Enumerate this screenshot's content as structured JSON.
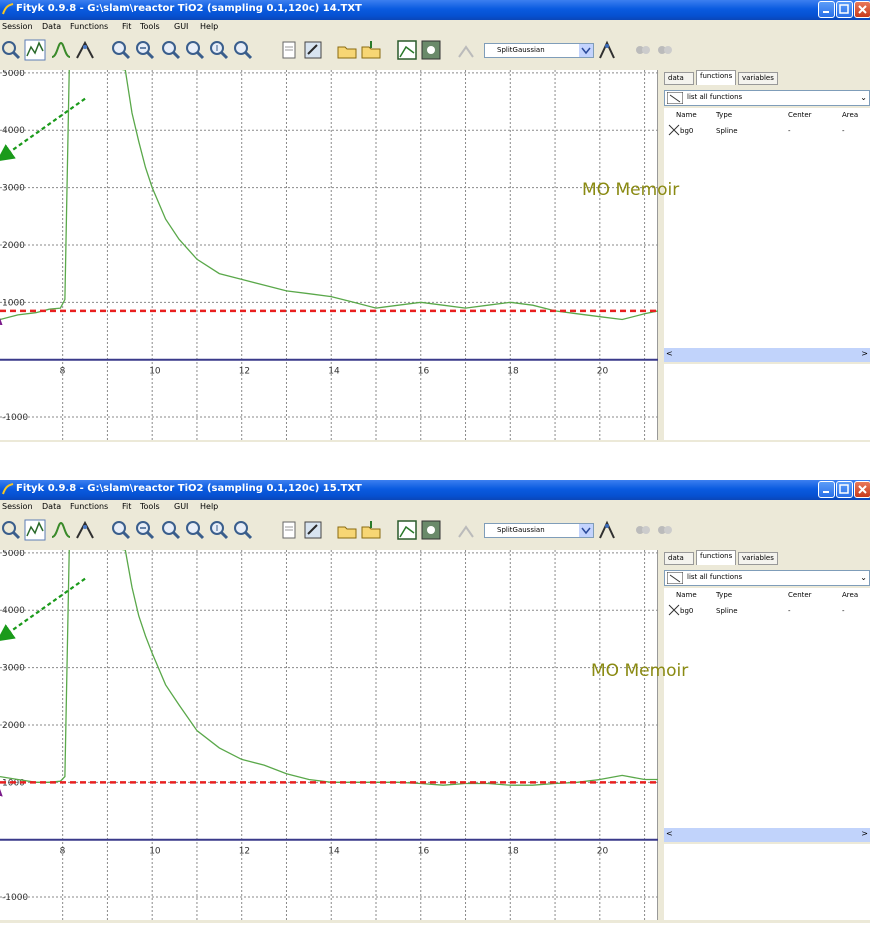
{
  "windows": [
    {
      "title": "Fityk 0.9.8 - G:\\slam\\reactor TiO2 (sampling 0.1,120c) 14.TXT",
      "menu": [
        "Session",
        "Data",
        "Functions",
        "Fit",
        "Tools",
        "GUI",
        "Help"
      ],
      "toolbar": {
        "icons": [
          "zoom-all-icon",
          "data-range-icon",
          "add-peak-icon",
          "run-fit-icon",
          "zoom-icon",
          "zoom-out-icon",
          "zoom-previous-icon",
          "zoom-next-icon",
          "zoom-visible-icon",
          "zoom-fit-icon",
          "add-data-icon",
          "edit-data-icon",
          "load-session-icon",
          "save-session-icon",
          "plot-icon",
          "export-image-icon",
          "auto-add-icon"
        ],
        "function_type": "SplitGaussian",
        "extra_icons": [
          "place-peak-icon",
          "undo-icon",
          "redo-icon"
        ]
      },
      "tabs": [
        "data",
        "functions",
        "variables"
      ],
      "active_tab": "functions",
      "function_filter": "list all functions",
      "table": {
        "columns": [
          "Name",
          "Type",
          "Center",
          "Area"
        ],
        "rows": [
          {
            "name": "bg0",
            "type": "Spline",
            "center": "-",
            "area": "-"
          }
        ]
      },
      "watermark": "MO Memoir",
      "chart_data": {
        "type": "line",
        "xlim": [
          6.6,
          21.3
        ],
        "ylim": [
          -1400,
          5050
        ],
        "x_ticks": [
          "8",
          "10",
          "12",
          "14",
          "16",
          "18",
          "20"
        ],
        "y_ticks": [
          "-1000",
          "1000",
          "2000",
          "3000",
          "4000",
          "5000"
        ],
        "grid": true,
        "series": [
          {
            "color": "#5aa84a",
            "x": [
              6.6,
              7.0,
              7.4,
              7.7,
              7.95,
              8.05,
              8.15,
              8.5,
              9.0,
              9.4,
              9.55,
              9.7,
              9.85,
              10.0,
              10.3,
              10.6,
              11.0,
              11.5,
              12.0,
              12.5,
              13.0,
              13.5,
              14.0,
              14.5,
              15.0,
              15.5,
              16.0,
              16.5,
              17.0,
              17.5,
              18.0,
              18.5,
              19.0,
              19.5,
              20.0,
              20.5,
              21.0,
              21.3
            ],
            "y": [
              700,
              780,
              820,
              880,
              900,
              1050,
              5200,
              5150,
              5100,
              5050,
              4300,
              3800,
              3350,
              3000,
              2450,
              2100,
              1750,
              1500,
              1400,
              1300,
              1200,
              1150,
              1100,
              1000,
              900,
              950,
              1000,
              950,
              900,
              950,
              1000,
              950,
              850,
              800,
              750,
              700,
              800,
              850
            ]
          }
        ],
        "annotations": [
          {
            "type": "dashed-hline",
            "y": 850,
            "color": "#e82020"
          },
          {
            "type": "dashed-arrow",
            "from": [
              8.5,
              4550
            ],
            "to": [
              6.6,
              3500
            ],
            "color": "#1a9a1a"
          },
          {
            "type": "dashed-arrow",
            "from": [
              6.3,
              -350
            ],
            "to": [
              6.5,
              850
            ],
            "color": "#7a1a8a"
          }
        ]
      }
    },
    {
      "title": "Fityk 0.9.8 - G:\\slam\\reactor TiO2 (sampling 0.1,120c) 15.TXT",
      "menu": [
        "Session",
        "Data",
        "Functions",
        "Fit",
        "Tools",
        "GUI",
        "Help"
      ],
      "toolbar": {
        "icons": [
          "zoom-all-icon",
          "data-range-icon",
          "add-peak-icon",
          "run-fit-icon",
          "zoom-icon",
          "zoom-out-icon",
          "zoom-previous-icon",
          "zoom-next-icon",
          "zoom-visible-icon",
          "zoom-fit-icon",
          "add-data-icon",
          "edit-data-icon",
          "load-session-icon",
          "save-session-icon",
          "plot-icon",
          "export-image-icon",
          "auto-add-icon"
        ],
        "function_type": "SplitGaussian",
        "extra_icons": [
          "place-peak-icon",
          "undo-icon",
          "redo-icon"
        ]
      },
      "tabs": [
        "data",
        "functions",
        "variables"
      ],
      "active_tab": "functions",
      "function_filter": "list all functions",
      "table": {
        "columns": [
          "Name",
          "Type",
          "Center",
          "Area"
        ],
        "rows": [
          {
            "name": "bg0",
            "type": "Spline",
            "center": "-",
            "area": "-"
          }
        ]
      },
      "watermark": "MO Memoir",
      "chart_data": {
        "type": "line",
        "xlim": [
          6.6,
          21.3
        ],
        "ylim": [
          -1400,
          5050
        ],
        "x_ticks": [
          "8",
          "10",
          "12",
          "14",
          "16",
          "18",
          "20"
        ],
        "y_ticks": [
          "-1000",
          "1000",
          "2000",
          "3000",
          "4000",
          "5000"
        ],
        "grid": true,
        "series": [
          {
            "color": "#5aa84a",
            "x": [
              6.6,
              7.0,
              7.4,
              7.7,
              7.95,
              8.05,
              8.15,
              8.5,
              9.0,
              9.4,
              9.55,
              9.7,
              9.85,
              10.0,
              10.3,
              10.6,
              11.0,
              11.5,
              12.0,
              12.5,
              13.0,
              13.5,
              14.0,
              14.5,
              15.0,
              15.5,
              16.0,
              16.5,
              17.0,
              17.5,
              18.0,
              18.5,
              19.0,
              19.5,
              20.0,
              20.5,
              21.0,
              21.3
            ],
            "y": [
              1100,
              1050,
              1000,
              1000,
              1020,
              1100,
              5200,
              5150,
              5100,
              5050,
              4400,
              3900,
              3550,
              3250,
              2700,
              2350,
              1900,
              1600,
              1400,
              1300,
              1150,
              1050,
              1000,
              1000,
              1000,
              1000,
              980,
              950,
              980,
              980,
              950,
              950,
              980,
              1000,
              1050,
              1120,
              1050,
              1050
            ]
          }
        ],
        "annotations": [
          {
            "type": "dashed-hline",
            "y": 1000,
            "color": "#e82020"
          },
          {
            "type": "dashed-arrow",
            "from": [
              8.5,
              4550
            ],
            "to": [
              6.6,
              3500
            ],
            "color": "#1a9a1a"
          },
          {
            "type": "dashed-arrow",
            "from": [
              6.3,
              -350
            ],
            "to": [
              6.5,
              1000
            ],
            "color": "#7a1a8a"
          }
        ]
      }
    }
  ]
}
